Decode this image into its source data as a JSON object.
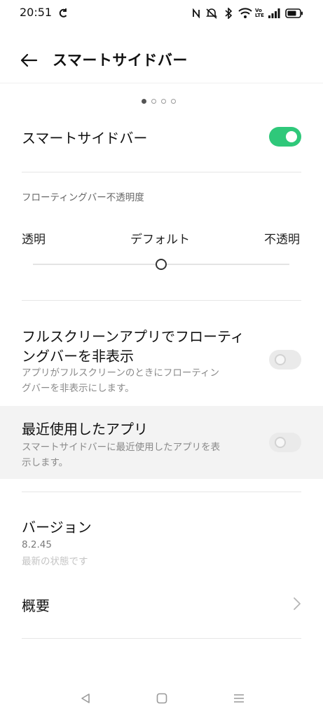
{
  "status_bar": {
    "time": "20:51",
    "icons": [
      "sync-icon",
      "nfc-icon",
      "mute-icon",
      "bluetooth-icon",
      "wifi-icon",
      "volte-icon",
      "signal-icon",
      "battery-icon"
    ],
    "volte_text": "Vo LTE"
  },
  "header": {
    "title": "スマートサイドバー"
  },
  "pager": {
    "count": 4,
    "active": 1
  },
  "smart_sidebar": {
    "label": "スマートサイドバー",
    "enabled": true
  },
  "opacity": {
    "section_title": "フローティングバー不透明度",
    "left_label": "透明",
    "center_label": "デフォルト",
    "right_label": "不透明",
    "value_fraction": 0.5
  },
  "fullscreen_hide": {
    "title_line1": "フルスクリーンアプリでフローティ",
    "title_line2": "ングバーを非表示",
    "desc_line1": "アプリがフルスクリーンのときにフローティン",
    "desc_line2": "グバーを非表示にします。",
    "enabled": false
  },
  "recent_apps": {
    "title": "最近使用したアプリ",
    "desc_line1": "スマートサイドバーに最近使用したアプリを表",
    "desc_line2": "示します。",
    "enabled": false
  },
  "version": {
    "title": "バージョン",
    "number": "8.2.45",
    "status": "最新の状態です"
  },
  "overview": {
    "label": "概要"
  },
  "nav_bar": {
    "icons": [
      "back-icon",
      "home-icon",
      "recents-icon"
    ]
  },
  "colors": {
    "accent": "#2fc87a",
    "toggle_off": "#eaeaea",
    "highlight": "#f3f3f3"
  }
}
